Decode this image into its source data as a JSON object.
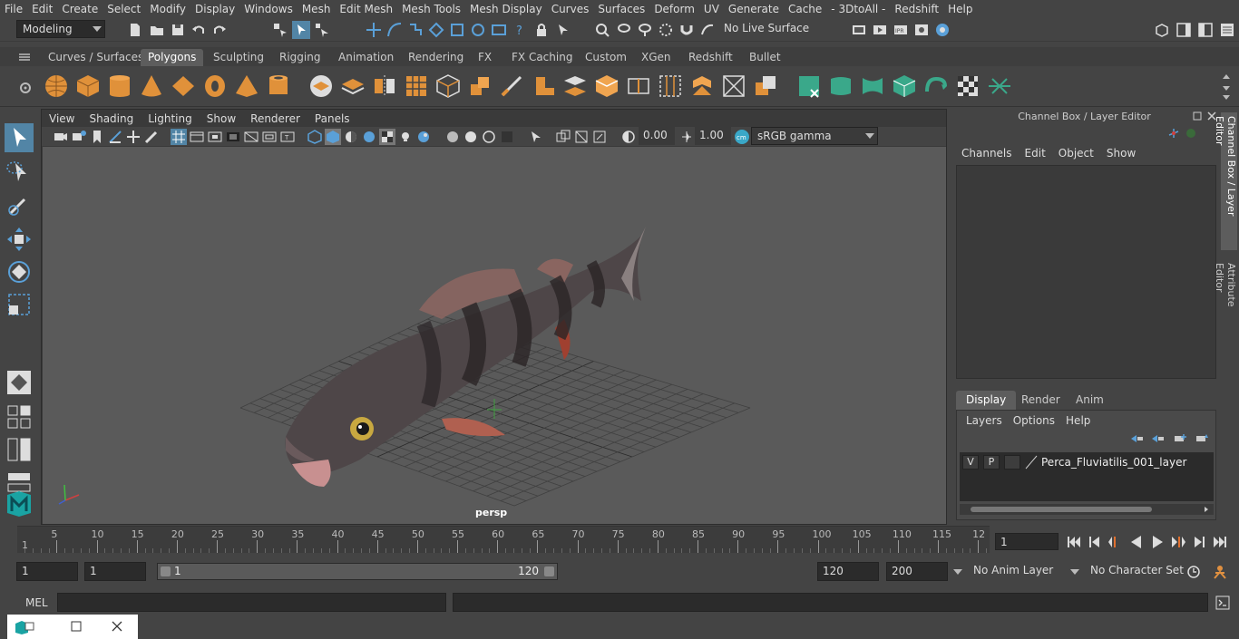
{
  "menubar": {
    "items": [
      "File",
      "Edit",
      "Create",
      "Select",
      "Modify",
      "Display",
      "Windows",
      "Mesh",
      "Edit Mesh",
      "Mesh Tools",
      "Mesh Display",
      "Curves",
      "Surfaces",
      "Deform",
      "UV",
      "Generate",
      "Cache",
      "- 3DtoAll -",
      "Redshift",
      "Help"
    ]
  },
  "statusline": {
    "mode": "Modeling",
    "live_surface": "No Live Surface"
  },
  "shelf": {
    "tabs": [
      "Curves / Surfaces",
      "Polygons",
      "Sculpting",
      "Rigging",
      "Animation",
      "Rendering",
      "FX",
      "FX Caching",
      "Custom",
      "XGen",
      "Redshift",
      "Bullet"
    ],
    "active_tab": "Polygons"
  },
  "viewport": {
    "menus": [
      "View",
      "Shading",
      "Lighting",
      "Show",
      "Renderer",
      "Panels"
    ],
    "exposure": "0.00",
    "gamma": "1.00",
    "color_space": "sRGB gamma",
    "camera": "persp"
  },
  "channelbox": {
    "title": "Channel Box / Layer Editor",
    "menus": [
      "Channels",
      "Edit",
      "Object",
      "Show"
    ],
    "layer_tabs": [
      "Display",
      "Render",
      "Anim"
    ],
    "active_layer_tab": "Display",
    "layer_menus": [
      "Layers",
      "Options",
      "Help"
    ],
    "layer": {
      "v": "V",
      "p": "P",
      "name": "Perca_Fluviatilis_001_layer"
    }
  },
  "side_tabs": [
    "Channel Box / Layer Editor",
    "Attribute Editor"
  ],
  "timeslider": {
    "ticks": [
      "5",
      "10",
      "15",
      "20",
      "25",
      "30",
      "35",
      "40",
      "45",
      "50",
      "55",
      "60",
      "65",
      "70",
      "75",
      "80",
      "85",
      "90",
      "95",
      "100",
      "105",
      "110",
      "115",
      "12"
    ],
    "start_label": "1",
    "current_frame": "1"
  },
  "rangeslider": {
    "start": "1",
    "playback_start": "1",
    "range_start_label": "1",
    "range_end_label": "120",
    "playback_end": "120",
    "end": "200",
    "anim_layer": "No Anim Layer",
    "character_set": "No Character Set"
  },
  "cmdline": {
    "label": "MEL"
  },
  "colors": {
    "accent": "#5285a6",
    "background": "#444444",
    "viewport": "#5a5a5a",
    "shelf_orange": "#e0913a",
    "shelf_green": "#3aa88a"
  }
}
